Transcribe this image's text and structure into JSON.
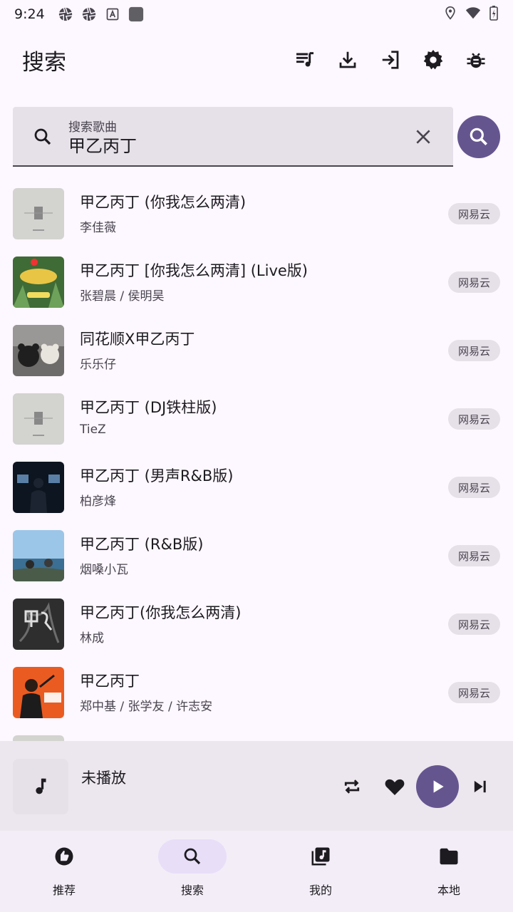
{
  "status_bar": {
    "time": "9:24"
  },
  "header": {
    "title": "搜索"
  },
  "search": {
    "label": "搜索歌曲",
    "value": "甲乙丙丁"
  },
  "results": [
    {
      "title": "甲乙丙丁 (你我怎么两清)",
      "artist": "李佳薇",
      "source": "网易云",
      "cover": "gray"
    },
    {
      "title": "甲乙丙丁 [你我怎么两清] (Live版)",
      "artist": "张碧晨 / 侯明昊",
      "source": "网易云",
      "cover": "green"
    },
    {
      "title": "同花顺X甲乙丙丁",
      "artist": "乐乐仔",
      "source": "网易云",
      "cover": "bears"
    },
    {
      "title": "甲乙丙丁 (DJ铁柱版)",
      "artist": "TieZ",
      "source": "网易云",
      "cover": "gray"
    },
    {
      "title": "甲乙丙丁 (男声R&B版)",
      "artist": "柏彦烽",
      "source": "网易云",
      "cover": "dark"
    },
    {
      "title": "甲乙丙丁 (R&B版)",
      "artist": "烟嗓小瓦",
      "source": "网易云",
      "cover": "sea"
    },
    {
      "title": "甲乙丙丁(你我怎么两清)",
      "artist": "林成",
      "source": "网易云",
      "cover": "smoke"
    },
    {
      "title": "甲乙丙丁",
      "artist": "郑中基 / 张学友 / 许志安",
      "source": "网易云",
      "cover": "orange"
    }
  ],
  "player": {
    "title": "未播放"
  },
  "nav": [
    {
      "label": "推荐",
      "icon": "recommend-icon",
      "active": false
    },
    {
      "label": "搜索",
      "icon": "search-icon",
      "active": true
    },
    {
      "label": "我的",
      "icon": "library-music-icon",
      "active": false
    },
    {
      "label": "本地",
      "icon": "folder-icon",
      "active": false
    }
  ],
  "colors": {
    "primary": "#65558f",
    "surface": "#fdf7ff",
    "chip": "#e6e0e9",
    "indicator": "#e8def8"
  }
}
